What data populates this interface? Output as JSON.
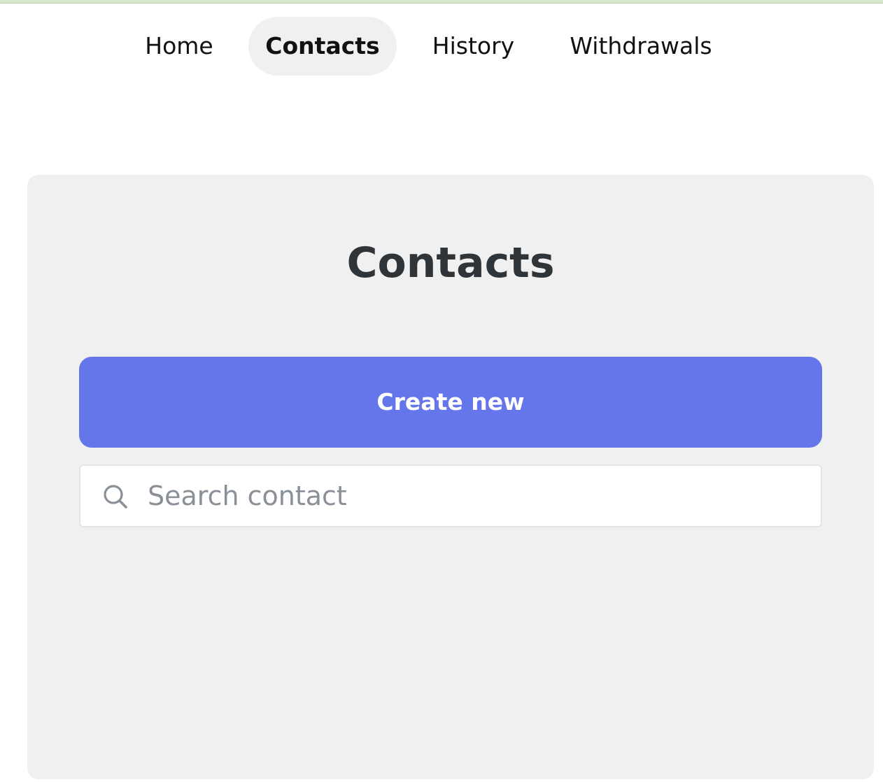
{
  "nav": {
    "items": [
      {
        "label": "Home",
        "active": false
      },
      {
        "label": "Contacts",
        "active": true
      },
      {
        "label": "History",
        "active": false
      },
      {
        "label": "Withdrawals",
        "active": false
      }
    ]
  },
  "main": {
    "title": "Contacts",
    "create_button_label": "Create new",
    "search": {
      "placeholder": "Search contact",
      "value": "",
      "icon": "search-icon"
    }
  },
  "colors": {
    "accent": "#6576ea",
    "panel_background": "#f0f0f0",
    "active_tab_background": "#f0f0f0",
    "title_text": "#2f3438",
    "placeholder_text": "#8a9098"
  }
}
